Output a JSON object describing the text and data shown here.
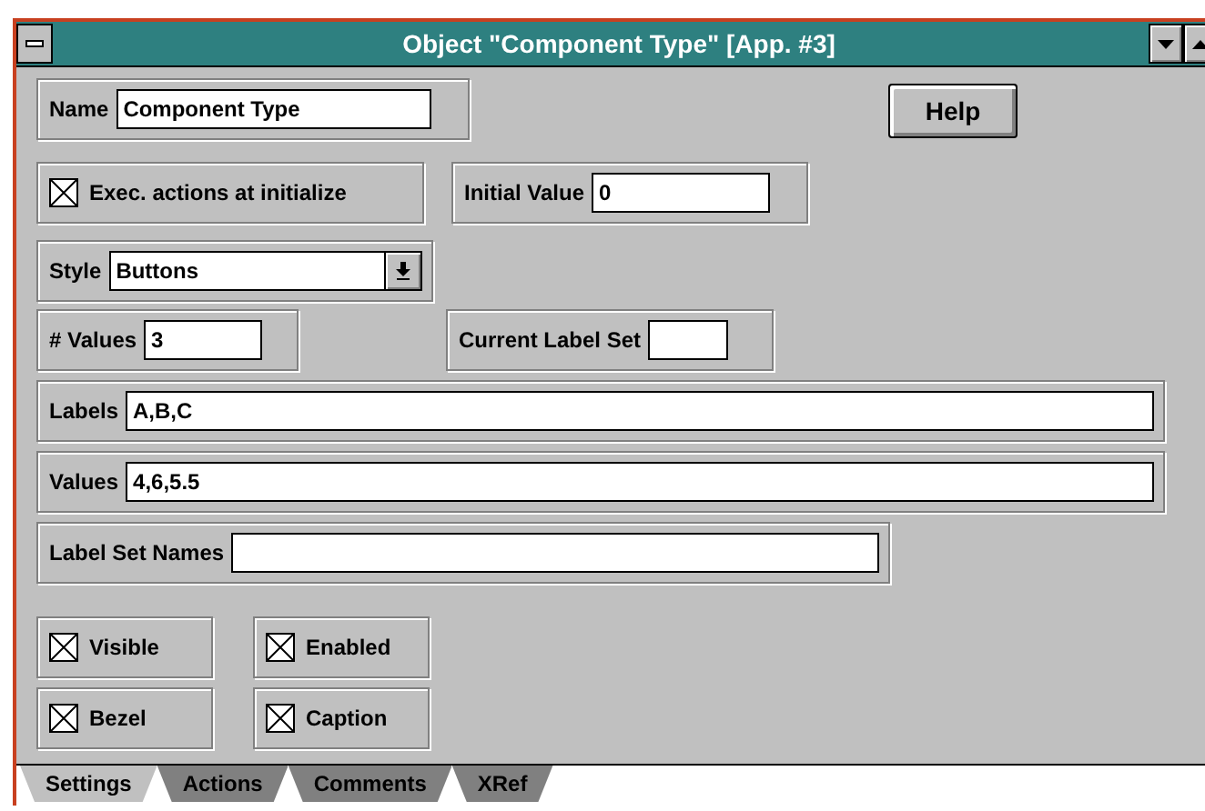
{
  "window": {
    "title": "Object \"Component Type\" [App. #3]"
  },
  "name": {
    "label": "Name",
    "value": "Component Type"
  },
  "help_button": {
    "label": "Help"
  },
  "exec_actions": {
    "label": "Exec. actions at initialize",
    "checked": true
  },
  "initial_value": {
    "label": "Initial Value",
    "value": "0"
  },
  "style": {
    "label": "Style",
    "value": "Buttons"
  },
  "num_values": {
    "label": "# Values",
    "value": "3"
  },
  "current_label_set": {
    "label": "Current Label Set"
  },
  "labels": {
    "label": "Labels",
    "value": "A,B,C"
  },
  "values": {
    "label": "Values",
    "value": "4,6,5.5"
  },
  "label_set_names": {
    "label": "Label Set Names"
  },
  "checkboxes": [
    {
      "label": "Visible",
      "checked": true
    },
    {
      "label": "Enabled",
      "checked": true
    },
    {
      "label": "Bezel",
      "checked": true
    },
    {
      "label": "Caption",
      "checked": true
    }
  ],
  "tabs": [
    {
      "label": "Settings",
      "selected": true
    },
    {
      "label": "Actions",
      "selected": false
    },
    {
      "label": "Comments",
      "selected": false
    },
    {
      "label": "XRef",
      "selected": false
    }
  ]
}
